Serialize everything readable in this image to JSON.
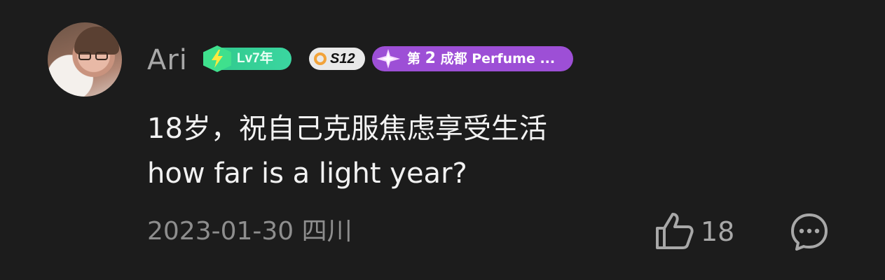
{
  "comment": {
    "username": "Ari",
    "badges": {
      "level": "Lv7年",
      "season": "S12",
      "rank_number": "2",
      "rank_prefix": "第",
      "rank_suffix": "成都 Perfume ..."
    },
    "content_line1": "18岁，祝自己克服焦虑享受生活",
    "content_line2": "how far is a light year?",
    "date": "2023-01-30",
    "location": "四川",
    "likes": "18"
  },
  "icons": {
    "avatar": "user-avatar",
    "level_badge": "lightning-bolt-icon",
    "season_badge": "ring-icon",
    "rank_badge": "star-icon",
    "like": "thumbs-up-icon",
    "reply": "chat-bubble-icon"
  },
  "colors": {
    "background": "#1c1c1c",
    "username": "#a8a8a8",
    "content": "#f2f2f2",
    "meta": "#8e8e8e",
    "level_badge": "#2fc88b",
    "rank_badge": "#9d4fd6"
  }
}
